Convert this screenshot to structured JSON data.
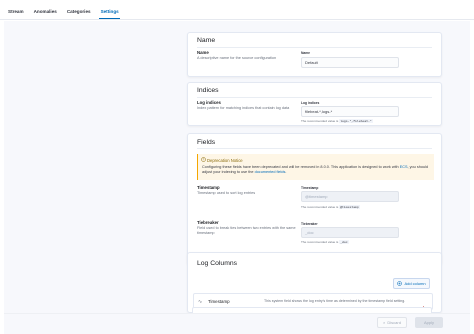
{
  "tabs": [
    {
      "label": "Stream",
      "active": false
    },
    {
      "label": "Anomalies",
      "active": false
    },
    {
      "label": "Categories",
      "active": false
    },
    {
      "label": "Settings",
      "active": true
    }
  ],
  "name_panel": {
    "title": "Name",
    "field_title": "Name",
    "field_desc": "A descriptive name for the source configuration",
    "input_label": "Name",
    "input_value": "Default"
  },
  "indices_panel": {
    "title": "Indices",
    "field_title": "Log indices",
    "field_desc": "Index pattern for matching indices that contain log data",
    "input_label": "Log indices",
    "input_value": "filebeat-*,logs-*",
    "help_prefix": "The recommended value is",
    "help_code": "logs-*,filebeat-*"
  },
  "fields_panel": {
    "title": "Fields",
    "callout_title": "Deprecation Notice",
    "callout_body_1": "Configuring these fields have been deprecated and will be removed in 8.0.0. This application is designed to work with",
    "callout_link_1": "ECS",
    "callout_body_2": ", you should adjust your indexing to use the",
    "callout_link_2": "documented fields",
    "callout_body_3": ".",
    "timestamp": {
      "title": "Timestamp",
      "desc": "Timestamp used to sort log entries",
      "input_label": "Timestamp",
      "input_value": "@timestamp",
      "help_prefix": "The recommended value is",
      "help_code": "@timestamp"
    },
    "tiebreaker": {
      "title": "Tiebreaker",
      "desc": "Field used to break ties between two entries with the same timestamp",
      "input_label": "Tiebreaker",
      "input_value": "_doc",
      "help_prefix": "The recommended value is",
      "help_code": "_doc"
    }
  },
  "columns_panel": {
    "title": "Log Columns",
    "add_label": "Add column",
    "rows": [
      {
        "name": "Timestamp",
        "desc": "This system field shows the log entry's time as determined by the   timestamp field setting."
      },
      {
        "name": "Message",
        "desc": "This system field shows the log entry message as derived from the document fields."
      }
    ]
  },
  "footer": {
    "discard_label": "Discard",
    "apply_label": "Apply"
  },
  "colors": {
    "accent": "#006bb8",
    "warning": "#f5a700",
    "danger": "#bd271e"
  },
  "icons": {
    "add": "plus-in-circle-icon",
    "callout": "help-circle-icon",
    "row_toggle": "chevron-icon",
    "row_delete": "trash-icon",
    "discard": "cross-icon"
  }
}
